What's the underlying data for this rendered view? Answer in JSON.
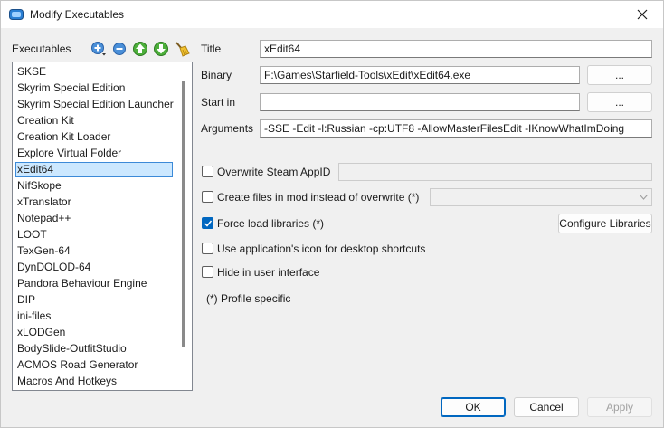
{
  "window": {
    "title": "Modify Executables",
    "accent": "#0067c0"
  },
  "left": {
    "label": "Executables",
    "toolbar": [
      "add-icon",
      "remove-icon",
      "move-up-icon",
      "move-down-icon",
      "clean-icon"
    ],
    "items": [
      "SKSE",
      "Skyrim Special Edition",
      "Skyrim Special Edition Launcher",
      "Creation Kit",
      "Creation Kit Loader",
      "Explore Virtual Folder",
      "xEdit64",
      "NifSkope",
      "xTranslator",
      "Notepad++",
      "LOOT",
      "TexGen-64",
      "DynDOLOD-64",
      "Pandora Behaviour Engine",
      "DIP",
      "ini-files",
      "xLODGen",
      "BodySlide-OutfitStudio",
      "ACMOS Road Generator",
      "Macros And Hotkeys"
    ],
    "selected_index": 6
  },
  "form": {
    "title_label": "Title",
    "title_value": "xEdit64",
    "binary_label": "Binary",
    "binary_value": "F:\\Games\\Starfield-Tools\\xEdit\\xEdit64.exe",
    "browse_label": "...",
    "startin_label": "Start in",
    "startin_value": "",
    "arguments_label": "Arguments",
    "arguments_value": "-SSE -Edit -l:Russian -cp:UTF8 -AllowMasterFilesEdit -IKnowWhatImDoing"
  },
  "options": {
    "steam_label": "Overwrite Steam AppID",
    "steam_value": "",
    "create_files_label": "Create files in mod instead of overwrite (*)",
    "force_load_label": "Force load libraries (*)",
    "configure_label": "Configure Libraries",
    "app_icon_label": "Use application's icon for desktop shortcuts",
    "hide_label": "Hide in user interface",
    "profile_note": "(*) Profile specific"
  },
  "footer": {
    "ok": "OK",
    "cancel": "Cancel",
    "apply": "Apply"
  }
}
